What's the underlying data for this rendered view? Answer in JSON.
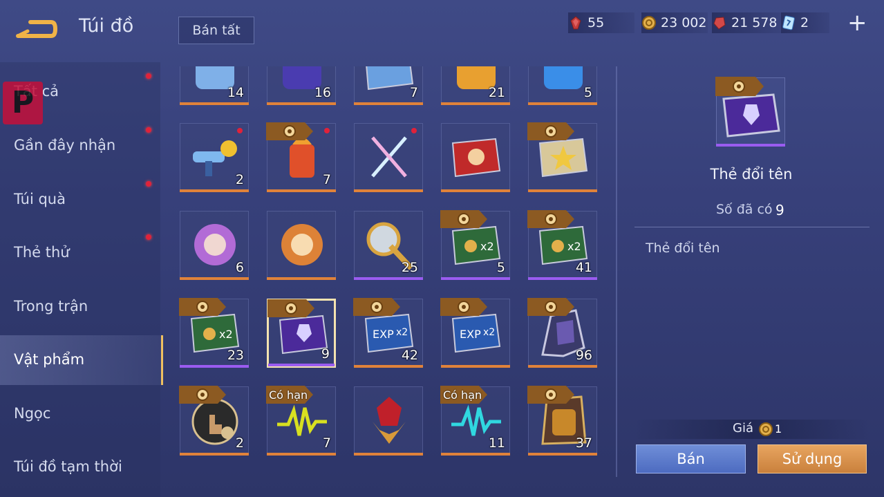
{
  "header": {
    "title": "Túi đồ",
    "sell_all_label": "Bán tất",
    "currencies": [
      {
        "icon": "red-gem-icon",
        "value": "55"
      },
      {
        "icon": "gold-coin-icon",
        "value": "23 002"
      },
      {
        "icon": "red-crystal-icon",
        "value": "21 578"
      },
      {
        "icon": "blue-voucher-icon",
        "value": "2"
      }
    ],
    "plus_label": "+"
  },
  "sidebar": {
    "items": [
      {
        "label": "Tất cả",
        "notify": true
      },
      {
        "label": "Gần đây nhận",
        "notify": true
      },
      {
        "label": "Túi quà",
        "notify": true
      },
      {
        "label": "Thẻ thử",
        "notify": true
      },
      {
        "label": "Trong trận",
        "notify": false
      },
      {
        "label": "Vật phẩm",
        "notify": false,
        "active": true
      },
      {
        "label": "Ngọc",
        "notify": false
      },
      {
        "label": "Túi đồ tạm thời",
        "notify": false
      }
    ]
  },
  "grid": {
    "rows": [
      [
        {
          "icon": "weapon-partial-icon",
          "qty": "14",
          "bar": "orange"
        },
        {
          "icon": "badge-partial-icon",
          "qty": "16",
          "bar": "orange"
        },
        {
          "icon": "hero-card-partial-icon",
          "qty": "7",
          "bar": "orange"
        },
        {
          "icon": "golden-bowl-partial-icon",
          "qty": "21",
          "bar": "orange"
        },
        {
          "icon": "ice-crystal-partial-icon",
          "qty": "5",
          "bar": "orange"
        }
      ],
      [
        {
          "icon": "toy-gun-icon",
          "qty": "2",
          "bar": "orange",
          "dot": true
        },
        {
          "icon": "fire-potion-icon",
          "qty": "7",
          "bar": "orange",
          "dot": true,
          "tag": "coin"
        },
        {
          "icon": "crossed-swords-icon",
          "qty": "",
          "bar": "orange",
          "dot": true
        },
        {
          "icon": "red-ticket-icon",
          "qty": "",
          "bar": "orange"
        },
        {
          "icon": "star-ticket-icon",
          "qty": "",
          "bar": "orange",
          "tag": "coin"
        }
      ],
      [
        {
          "icon": "purple-orb-icon",
          "qty": "6",
          "bar": "orange"
        },
        {
          "icon": "orange-orb-icon",
          "qty": "",
          "bar": "orange"
        },
        {
          "icon": "golden-scepter-icon",
          "qty": "25",
          "bar": "purple"
        },
        {
          "icon": "gold-x2-card-icon",
          "qty": "5",
          "bar": "purple",
          "tag": "coin"
        },
        {
          "icon": "gold-x2-card-icon",
          "qty": "41",
          "bar": "purple",
          "tag": "coin"
        }
      ],
      [
        {
          "icon": "gold-x2-card-icon",
          "qty": "23",
          "bar": "purple",
          "tag": "coin"
        },
        {
          "icon": "rename-card-icon",
          "qty": "9",
          "bar": "purple",
          "tag": "coin",
          "selected": true
        },
        {
          "icon": "exp-x2-card-icon",
          "qty": "42",
          "bar": "orange",
          "tag": "coin"
        },
        {
          "icon": "exp-x2-card-icon",
          "qty": "",
          "bar": "orange",
          "tag": "coin"
        },
        {
          "icon": "knight-helmet-icon",
          "qty": "96",
          "bar": "orange",
          "tag": "coin"
        }
      ],
      [
        {
          "icon": "hand-tap-icon",
          "qty": "2",
          "bar": "orange",
          "tag": "coin"
        },
        {
          "icon": "yellow-pulse-icon",
          "qty": "7",
          "bar": "orange",
          "tag": "Có hạn"
        },
        {
          "icon": "ruby-gem-icon",
          "qty": "",
          "bar": "orange"
        },
        {
          "icon": "cyan-pulse-icon",
          "qty": "11",
          "bar": "orange",
          "tag": "Có hạn"
        },
        {
          "icon": "gold-armor-icon",
          "qty": "37",
          "bar": "orange",
          "tag": "coin"
        }
      ]
    ]
  },
  "detail": {
    "icon": "rename-card-icon",
    "name": "Thẻ đổi tên",
    "owned_label": "Số đã có",
    "owned_value": "9",
    "description": "Thẻ đổi tên",
    "price_label": "Giá",
    "price_value": "1",
    "sell_label": "Bán",
    "use_label": "Sử dụng"
  },
  "colors": {
    "accent_orange": "#e0823a",
    "accent_purple": "#9a5cf0",
    "notify_red": "#e0223a"
  }
}
